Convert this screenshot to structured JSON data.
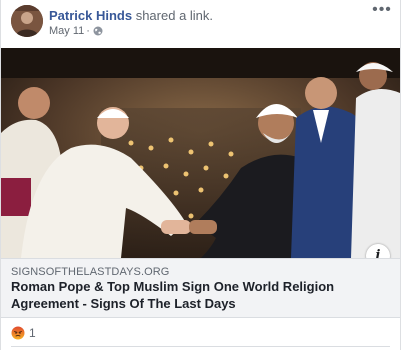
{
  "post": {
    "poster_name": "Patrick Hinds",
    "action_text": " shared a link.",
    "date": "May 11",
    "date_separator": "·",
    "more_icon": "ellipsis-icon",
    "privacy_icon": "globe-icon"
  },
  "link_preview": {
    "domain": "SIGNSOFTHELASTDAYS.ORG",
    "title": "Roman Pope & Top Muslim Sign One World Religion Agreement - Signs Of The Last Days",
    "info_icon": "info-icon",
    "info_glyph": "i"
  },
  "reactions": {
    "icon": "angry-reaction-icon",
    "count": "1"
  },
  "colors": {
    "link_blue": "#385898",
    "meta_gray": "#606770",
    "preview_bg": "#f2f3f5",
    "angry_red": "#e9710f"
  }
}
